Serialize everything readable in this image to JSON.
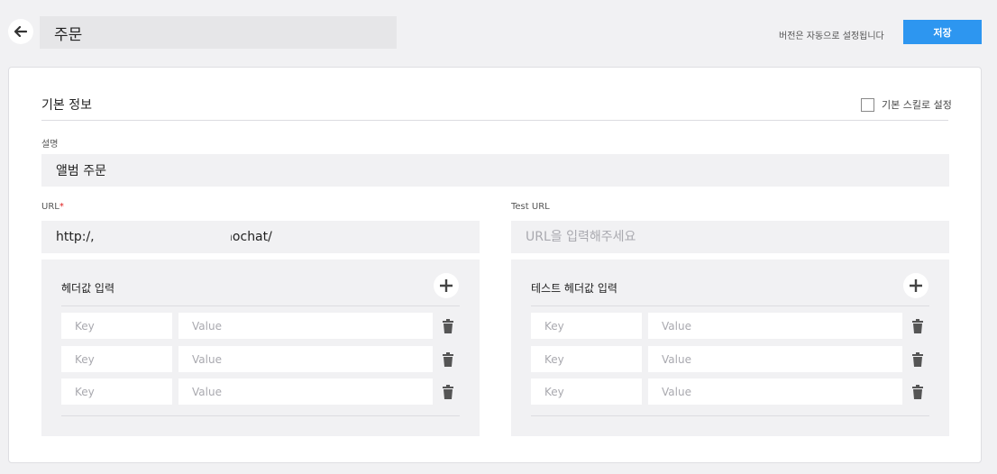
{
  "header": {
    "title_value": "주문",
    "version_note": "버전은 자동으로 설정됩니다",
    "save_label": "저장"
  },
  "basic_info": {
    "title": "기본 정보",
    "default_skill_label": "기본 스킬로 설정",
    "default_skill_checked": false
  },
  "description": {
    "label": "설명",
    "value": "앨범 주문"
  },
  "url": {
    "label": "URL",
    "required_mark": "*",
    "value": "http:/,                          /kakaochat/"
  },
  "test_url": {
    "label": "Test URL",
    "placeholder": "URL을 입력해주세요"
  },
  "headers": {
    "title": "헤더값 입력",
    "rows": [
      {
        "key_placeholder": "Key",
        "value_placeholder": "Value"
      },
      {
        "key_placeholder": "Key",
        "value_placeholder": "Value"
      },
      {
        "key_placeholder": "Key",
        "value_placeholder": "Value"
      }
    ]
  },
  "test_headers": {
    "title": "테스트 헤더값 입력",
    "rows": [
      {
        "key_placeholder": "Key",
        "value_placeholder": "Value"
      },
      {
        "key_placeholder": "Key",
        "value_placeholder": "Value"
      },
      {
        "key_placeholder": "Key",
        "value_placeholder": "Value"
      }
    ]
  },
  "colors": {
    "accent": "#2d96f0",
    "required": "#e02020",
    "input_bg": "#f1f1f3"
  },
  "icons": {
    "back": "arrow-left-icon",
    "add": "plus-icon",
    "delete": "trash-icon"
  }
}
